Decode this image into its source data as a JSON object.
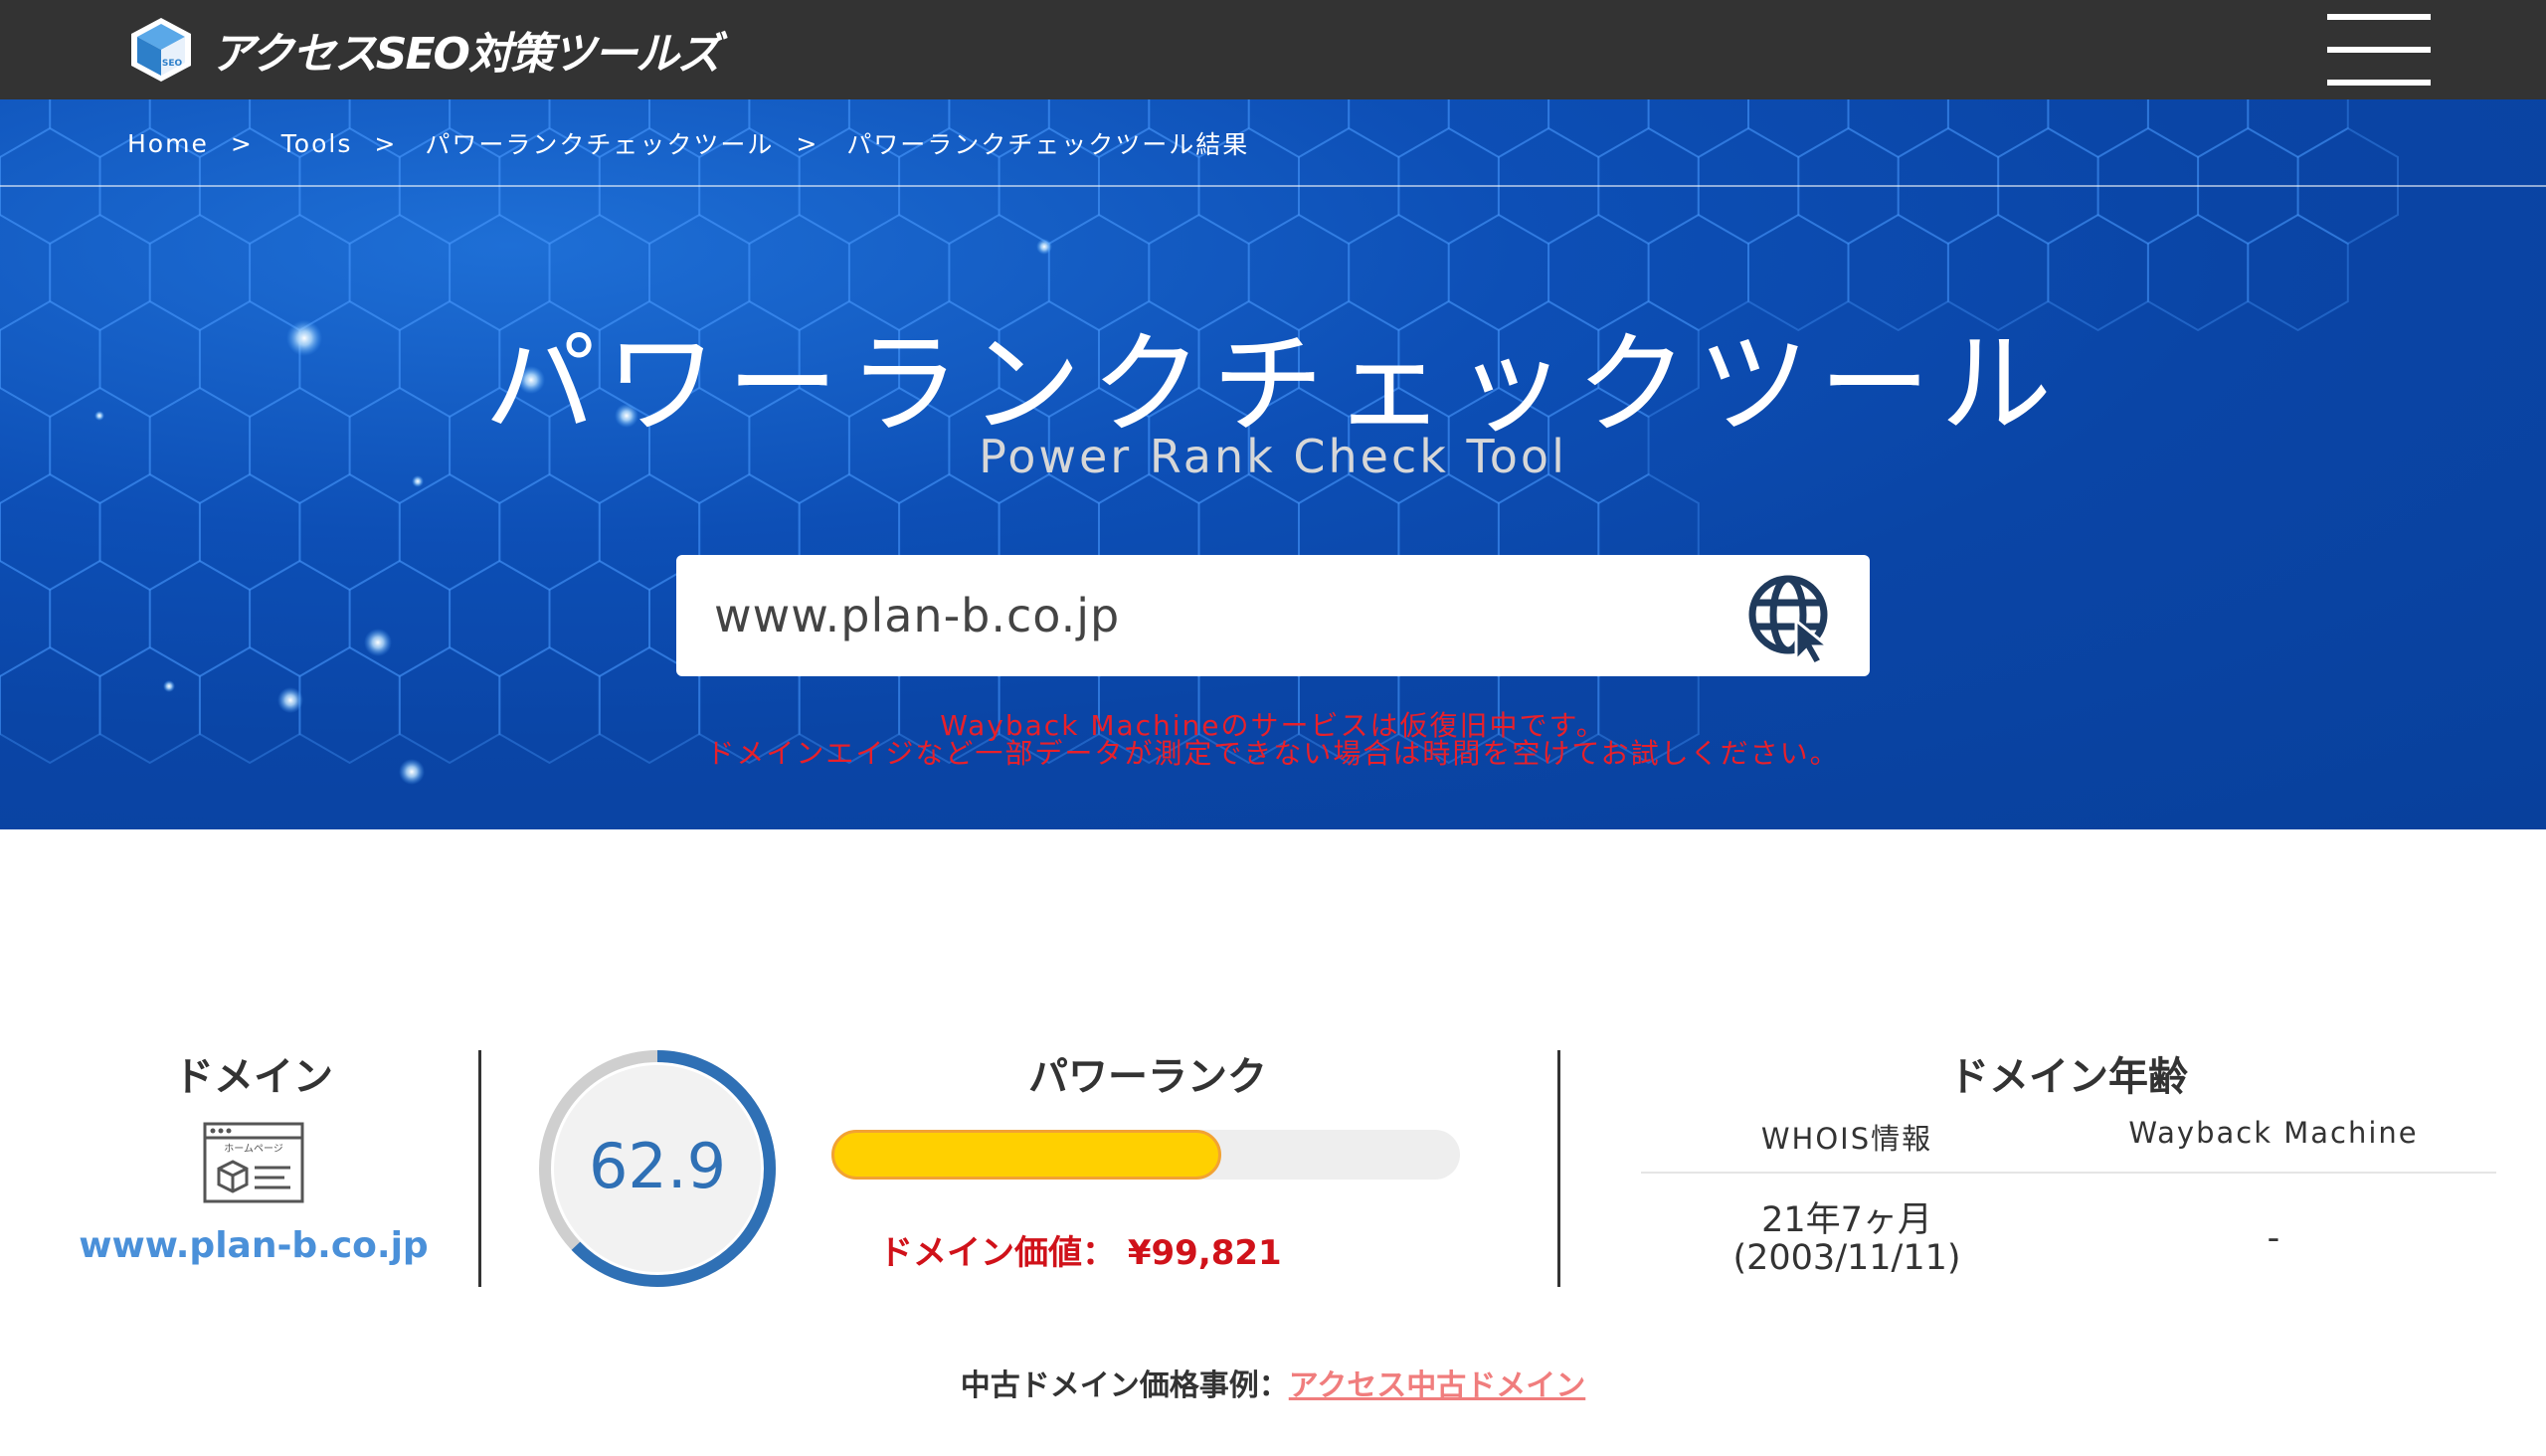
{
  "header": {
    "logo_text": "アクセスSEO対策ツールズ",
    "logo_badge": "SEO"
  },
  "breadcrumb": [
    "Home",
    "Tools",
    "パワーランクチェックツール",
    "パワーランクチェックツール結果"
  ],
  "breadcrumb_separator": ">",
  "hero": {
    "title": "パワーランクチェックツール",
    "subtitle": "Power Rank Check Tool",
    "search_value": "www.plan-b.co.jp",
    "notice_line1": "Wayback Machineのサービスは仮復旧中です。",
    "notice_line2": "ドメインエイジなど一部データが測定できない場合は時間を空けてお試しください。"
  },
  "results": {
    "domain_title": "ドメイン",
    "domain_icon_label": "ホームページ",
    "domain_name": "www.plan-b.co.jp",
    "power_rank_title": "パワーランク",
    "score": "62.9",
    "score_fraction": 0.629,
    "bar_fraction": 0.62,
    "domain_value_label": "ドメイン価値：",
    "domain_value": "¥99,821",
    "age_title": "ドメイン年齢",
    "whois_header": "WHOIS情報",
    "wayback_header": "Wayback Machine",
    "whois_age": "21年7ヶ月",
    "whois_date": "(2003/11/11)",
    "wayback_value": "-",
    "example_label": "中古ドメイン価格事例：",
    "example_link": "アクセス中古ドメイン"
  },
  "colors": {
    "header_bg": "#333333",
    "hero_blue": "#0a45a6",
    "accent_blue": "#2f70b5",
    "bar_yellow": "#ffd000",
    "alert_red": "#e8202a"
  }
}
